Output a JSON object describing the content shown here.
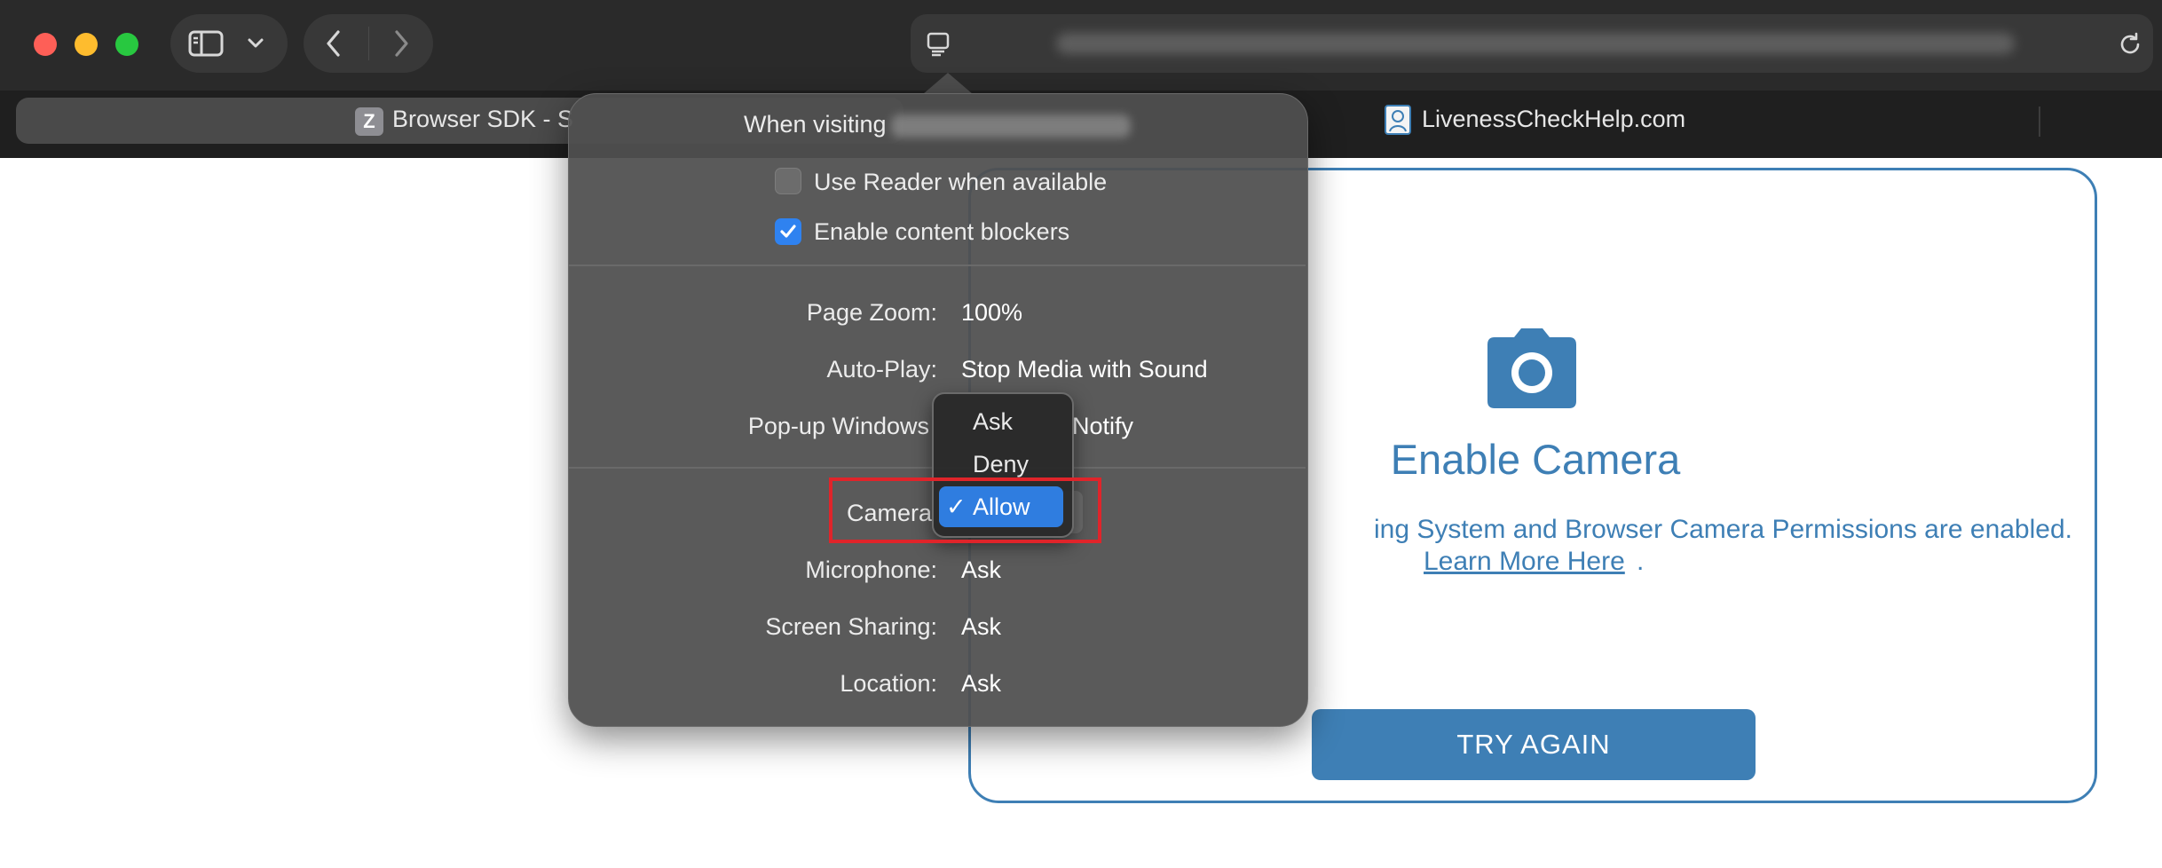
{
  "browser": {
    "tabs": [
      {
        "label": "Browser SDK - S",
        "favicon_letter": "Z",
        "active": true
      },
      {
        "label": "LivenessCheckHelp.com",
        "active": false
      }
    ]
  },
  "page": {
    "title": "Enable Camera",
    "description": "ing System and Browser Camera Permissions are enabled.",
    "learn_more": "Learn More Here",
    "learn_more_suffix": ".",
    "try_again": "TRY AGAIN",
    "accent_color": "#3e7fb5"
  },
  "popover": {
    "header_prefix": "When visiting",
    "checkboxes": {
      "reader": {
        "label": "Use Reader when available",
        "checked": false
      },
      "blockers": {
        "label": "Enable content blockers",
        "checked": true
      }
    },
    "settings": {
      "zoom": {
        "label": "Page Zoom:",
        "value": "100%"
      },
      "autoplay": {
        "label": "Auto-Play:",
        "value": "Stop Media with Sound"
      },
      "popups": {
        "label": "Pop-up Windows",
        "value": "Notify"
      },
      "camera": {
        "label": "Camera",
        "value": "Allow"
      },
      "microphone": {
        "label": "Microphone:",
        "value": "Ask"
      },
      "screen_sharing": {
        "label": "Screen Sharing:",
        "value": "Ask"
      },
      "location": {
        "label": "Location:",
        "value": "Ask"
      }
    }
  },
  "dropdown": {
    "options": [
      "Ask",
      "Deny",
      "Allow"
    ],
    "selected": "Allow",
    "check_mark": "✓",
    "highlight_color": "#e0242a"
  }
}
